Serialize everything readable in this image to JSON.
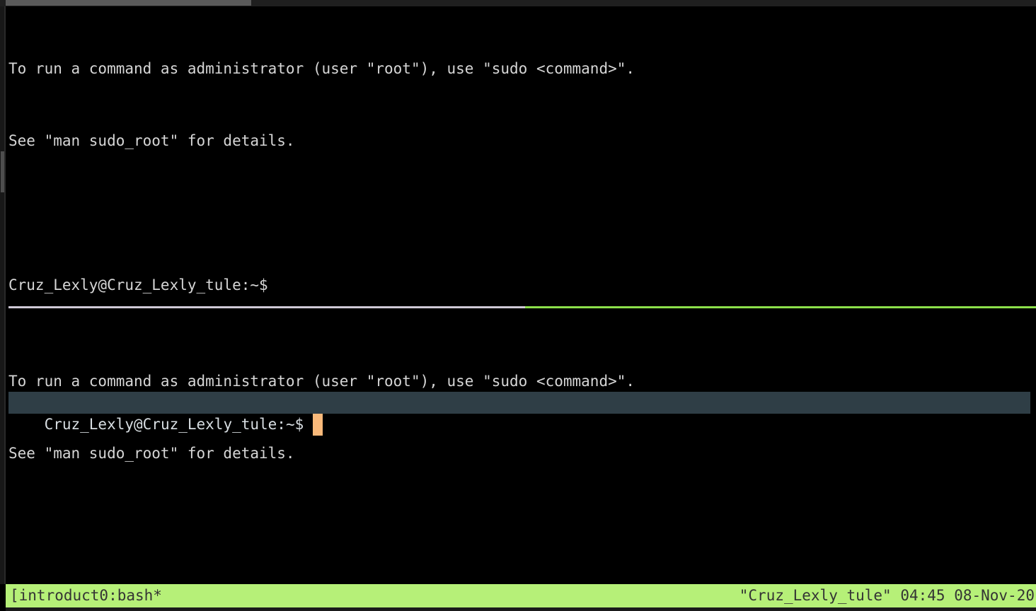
{
  "window": {
    "background_color": "#000000",
    "foreground_color": "#d6d6d6"
  },
  "scrollbars": {
    "horizontal_name": "horizontal-scrollbar",
    "vertical_name": "vertical-scrollbar"
  },
  "panes": {
    "top": {
      "lines": [
        "To run a command as administrator (user \"root\"), use \"sudo <command>\".",
        "See \"man sudo_root\" for details.",
        "",
        "Cruz_Lexly@Cruz_Lexly_tule:~$"
      ]
    },
    "bottom": {
      "lines": [
        "To run a command as administrator (user \"root\"), use \"sudo <command>\".",
        "See \"man sudo_root\" for details.",
        ""
      ],
      "prompt": "Cruz_Lexly@Cruz_Lexly_tule:~$ ",
      "cursor": " "
    }
  },
  "divider": {
    "inactive_color": "#cfc9d6",
    "active_color": "#8ce04a"
  },
  "prompt_highlight": {
    "background_color": "#2f3e46",
    "cursor_color": "#f9b97a"
  },
  "status_bar": {
    "left": "[introduct0:bash*",
    "right": "\"Cruz_Lexly_tule\" 04:45 08-Nov-20",
    "background_color": "#b6f078",
    "text_color": "#343434"
  }
}
